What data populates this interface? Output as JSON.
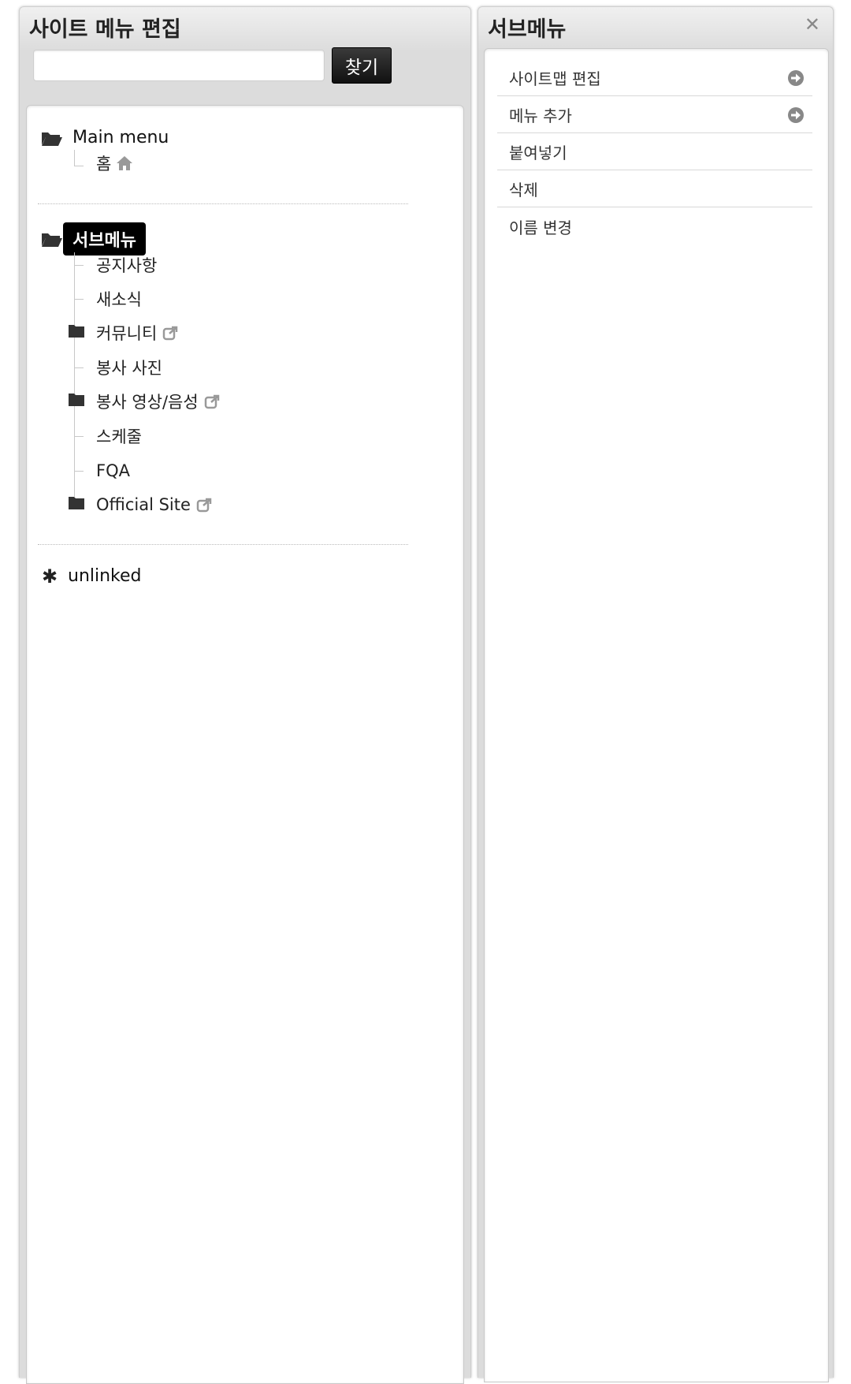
{
  "left_panel": {
    "title": "사이트 메뉴 편집",
    "search": {
      "value": "",
      "placeholder": "",
      "button_label": "찾기"
    },
    "trees": [
      {
        "label": "Main menu",
        "icon": "folder-open-icon",
        "selected": false,
        "children": [
          {
            "label": "홈",
            "icon": "home-icon"
          }
        ]
      },
      {
        "label": "서브메뉴",
        "icon": "folder-open-icon",
        "selected": true,
        "children": [
          {
            "label": "공지사항"
          },
          {
            "label": "새소식"
          },
          {
            "label": "커뮤니티",
            "folder": true,
            "icon": "external-link-icon"
          },
          {
            "label": "봉사 사진"
          },
          {
            "label": "봉사 영상/음성",
            "folder": true,
            "icon": "external-link-icon"
          },
          {
            "label": "스케줄"
          },
          {
            "label": "FQA"
          },
          {
            "label": "Official Site",
            "folder": true,
            "icon": "external-link-icon"
          }
        ]
      },
      {
        "label": "unlinked",
        "icon": "asterisk-icon",
        "selected": false,
        "children": []
      }
    ]
  },
  "right_panel": {
    "title": "서브메뉴",
    "close_icon": "close-icon",
    "items": [
      {
        "label": "사이트맵 편집",
        "icon": "arrow-right-circle-icon"
      },
      {
        "label": "메뉴 추가",
        "icon": "arrow-right-circle-icon"
      },
      {
        "label": "붙여넣기"
      },
      {
        "label": "삭제"
      },
      {
        "label": "이름 변경"
      }
    ]
  }
}
